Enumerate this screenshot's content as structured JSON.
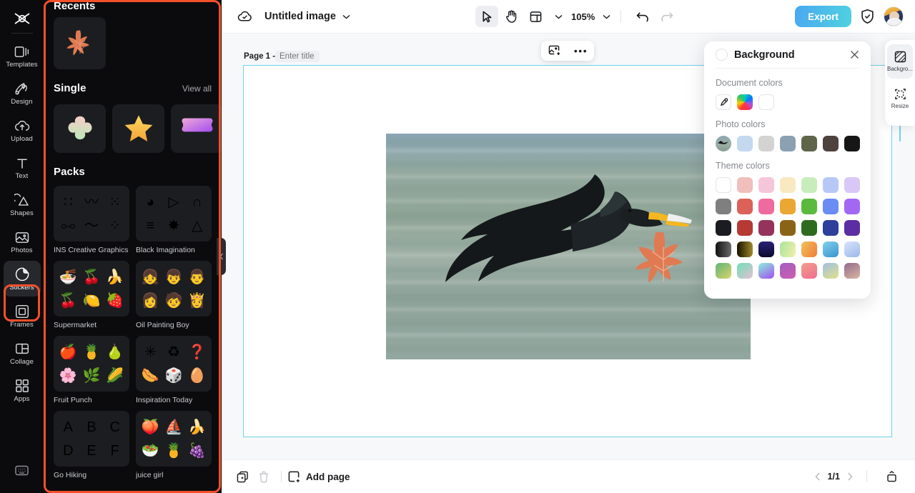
{
  "app": {
    "rail": {
      "logo_icon": "capcut-logo-icon",
      "items": [
        {
          "label": "Templates",
          "icon": "templates-icon",
          "active": false
        },
        {
          "label": "Design",
          "icon": "design-icon",
          "active": false
        },
        {
          "label": "Upload",
          "icon": "upload-cloud-icon",
          "active": false
        },
        {
          "label": "Text",
          "icon": "text-icon",
          "active": false
        },
        {
          "label": "Shapes",
          "icon": "shapes-icon",
          "active": false
        },
        {
          "label": "Photos",
          "icon": "photos-icon",
          "active": false
        },
        {
          "label": "Stickers",
          "icon": "stickers-icon",
          "active": true
        },
        {
          "label": "Frames",
          "icon": "frames-icon",
          "active": false
        },
        {
          "label": "Collage",
          "icon": "collage-icon",
          "active": false
        },
        {
          "label": "Apps",
          "icon": "apps-grid-icon",
          "active": false
        }
      ],
      "bottom_icon": "keyboard-shortcuts-icon",
      "highlight_color": "#f4502a"
    },
    "stickers_panel": {
      "recents_title": "Recents",
      "recents": [
        {
          "name": "maple-leaf-sticker"
        }
      ],
      "single_title": "Single",
      "view_all_label": "View all",
      "single_items": [
        {
          "name": "clover-sticker"
        },
        {
          "name": "star-sticker"
        },
        {
          "name": "gradient-blob-sticker"
        }
      ],
      "next_arrow_icon": "chevron-right-icon",
      "packs_title": "Packs",
      "packs": [
        {
          "name": "INS Creative Graphics",
          "glyphs": [
            "∷",
            "〰",
            "⁙",
            "⧟",
            "〜",
            "⁘"
          ]
        },
        {
          "name": "Black Imagination",
          "glyphs": [
            "◕",
            "▷",
            "∩",
            "≡",
            "✸",
            "△"
          ]
        },
        {
          "name": "Supermarket",
          "glyphs": [
            "🍜",
            "🍒",
            "🍌",
            "🍒",
            "🍋",
            "🍓"
          ]
        },
        {
          "name": "Oil Painting Boy",
          "glyphs": [
            "👧",
            "👦",
            "👨",
            "👩",
            "🧒",
            "👸"
          ]
        },
        {
          "name": "Fruit Punch",
          "glyphs": [
            "🍎",
            "🍍",
            "🍐",
            "🌸",
            "🌿",
            "🌽"
          ]
        },
        {
          "name": "Inspiration Today",
          "glyphs": [
            "✳",
            "♻",
            "❓",
            "🌭",
            "🎲",
            "🥚"
          ]
        },
        {
          "name": "Go Hiking",
          "glyphs": [
            "A",
            "B",
            "C",
            "D",
            "E",
            "F"
          ]
        },
        {
          "name": "juice girl",
          "glyphs": [
            "🍑",
            "⛵",
            "🍌",
            "🥗",
            "🍍",
            "🍇"
          ]
        }
      ],
      "collapse_icon": "chevron-left-icon"
    },
    "topbar": {
      "cloud_icon": "cloud-saved-icon",
      "doc_title": "Untitled image",
      "title_caret_icon": "chevron-down-icon",
      "tools": [
        {
          "name": "select-tool",
          "icon": "cursor-arrow-icon",
          "selected": true
        },
        {
          "name": "hand-tool",
          "icon": "hand-icon",
          "selected": false
        },
        {
          "name": "layout-tool",
          "icon": "layout-icon",
          "selected": false
        }
      ],
      "layout_caret_icon": "chevron-down-icon",
      "zoom_level": "105%",
      "zoom_caret_icon": "chevron-down-icon",
      "undo_icon": "undo-icon",
      "redo_icon": "redo-icon",
      "export_label": "Export",
      "shield_icon": "shield-check-icon",
      "avatar_name": "user-avatar"
    },
    "canvas": {
      "page_label": "Page 1 -",
      "page_title_placeholder": "Enter title",
      "float_toolbar": {
        "replace_image_icon": "add-image-icon",
        "more_icon": "more-options-icon"
      },
      "selection_color": "#6fd3e8",
      "photo_alt": "cormorant-flying-over-water-photo",
      "leaf_overlay_name": "maple-leaf-overlay"
    },
    "background_panel": {
      "title": "Background",
      "close_icon": "close-icon",
      "document_colors_label": "Document colors",
      "document_colors": [
        {
          "name": "eyedropper-swatch",
          "type": "picker",
          "icon": "eyedropper-icon"
        },
        {
          "name": "rainbow-swatch",
          "type": "rainbow"
        },
        {
          "name": "white-swatch",
          "hex": "#ffffff"
        }
      ],
      "photo_colors_label": "Photo colors",
      "photo_colors": [
        {
          "name": "source-photo-swatch",
          "type": "photo"
        },
        {
          "hex": "#c3d9ee"
        },
        {
          "hex": "#d3d3d1"
        },
        {
          "hex": "#8ba0b1"
        },
        {
          "hex": "#5e6548"
        },
        {
          "hex": "#4d423e"
        },
        {
          "hex": "#171616"
        }
      ],
      "theme_colors_label": "Theme colors",
      "theme_colors": [
        [
          "#ffffff",
          "#f0bfbb",
          "#f5c6da",
          "#f8e9c0",
          "#c7eeba",
          "#b8c8f6",
          "#d9c8f7"
        ],
        [
          "#7f7f7f",
          "#dc6159",
          "#ef6a9e",
          "#eaa732",
          "#59ba3d",
          "#6a8cf5",
          "#a268f3"
        ],
        [
          "#1b1b22",
          "#b53a34",
          "#95335c",
          "#8a6416",
          "#2d6c1f",
          "#2e409b",
          "#5b2ea3"
        ],
        [
          "#2b2b2b",
          "#171000",
          "#141447",
          "#aae39d",
          "#ef9b45",
          "#54b0dd",
          "#bcd4f6"
        ],
        [
          "#74b36a",
          "#79e0bb",
          "#b86cf5",
          "#a05fc0",
          "#ef8f8f",
          "#9ec0e2",
          "#8c7592"
        ]
      ],
      "theme_gradients": {
        "row4": [
          "linear-gradient(90deg,#111111,#6b6b6b)",
          "linear-gradient(90deg,#171000,#a08a2a)",
          "linear-gradient(180deg,#2a2176,#0b0b2e)",
          "linear-gradient(110deg,#aae39d,#f2f0a8)",
          "linear-gradient(120deg,#f0c05a,#ef7d3a)",
          "linear-gradient(150deg,#7fd0ea,#3b94cf)",
          "linear-gradient(150deg,#d8e4fb,#9bb8ea)"
        ],
        "row5": [
          "linear-gradient(140deg,#5fb377,#d9d56a)",
          "linear-gradient(140deg,#6ee0b8,#e5bfd4)",
          "linear-gradient(150deg,#8af0d8,#a34ef2)",
          "linear-gradient(150deg,#9f5fc0,#d05bb0)",
          "linear-gradient(150deg,#f0a08a,#ef6d8f)",
          "linear-gradient(150deg,#9ec0e2,#e2e08a)",
          "linear-gradient(150deg,#93698f,#d9b7a0)"
        ]
      }
    },
    "right_rail": {
      "items": [
        {
          "label": "Backgro...",
          "icon": "background-icon",
          "active": true
        },
        {
          "label": "Resize",
          "icon": "resize-icon",
          "active": false
        }
      ]
    },
    "bottombar": {
      "duplicate_icon": "duplicate-page-icon",
      "delete_icon": "trash-icon",
      "add_page_icon": "add-page-icon",
      "add_page_label": "Add page",
      "prev_icon": "chevron-left-icon",
      "page_indicator": "1/1",
      "next_icon": "chevron-right-icon",
      "grid_view_icon": "grid-view-icon"
    }
  }
}
